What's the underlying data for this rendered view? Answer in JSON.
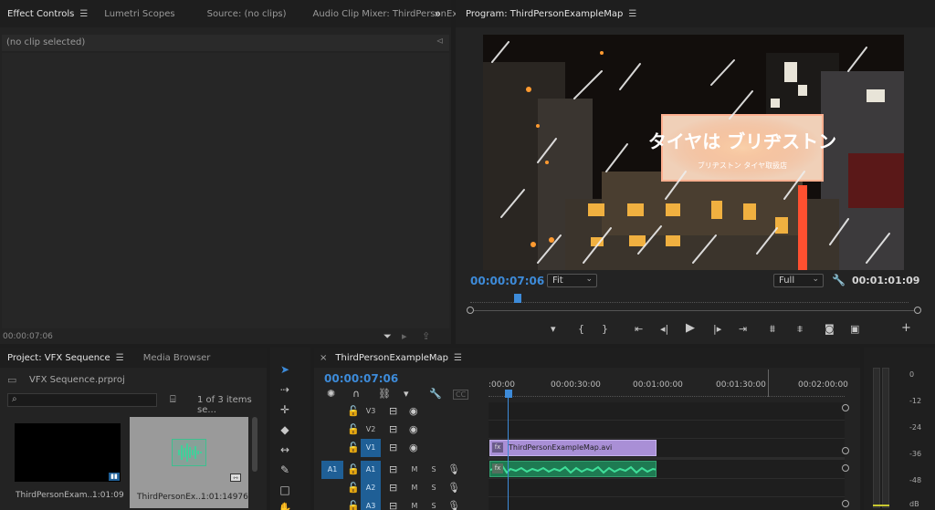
{
  "effect_panel": {
    "tabs": [
      {
        "label": "Effect Controls",
        "active": true
      },
      {
        "label": "Lumetri Scopes"
      },
      {
        "label": "Source: (no clips)"
      },
      {
        "label": "Audio Clip Mixer: ThirdPersonExampleM"
      }
    ],
    "no_clip": "(no clip selected)",
    "timecode": "00:00:07:06",
    "more_icon": "»"
  },
  "program": {
    "title": "Program: ThirdPersonExampleMap",
    "timecode": "00:00:07:06",
    "fit": "Fit",
    "quality": "Full",
    "duration": "00:01:01:09",
    "sign_text": "タイヤは ブリヂストン",
    "sign_sub": "ブリヂストン タイヤ取扱店"
  },
  "project": {
    "tabs": [
      {
        "label": "Project: VFX Sequence",
        "active": true
      },
      {
        "label": "Media Browser"
      }
    ],
    "file": "VFX Sequence.prproj",
    "count": "1 of 3 items se...",
    "items": [
      {
        "name": "ThirdPersonExam...",
        "duration": "1:01:09"
      },
      {
        "name": "ThirdPersonEx...",
        "duration": "1:01:14976"
      }
    ]
  },
  "timeline": {
    "title": "ThirdPersonExampleMap",
    "timecode": "00:00:07:06",
    "ruler": [
      ":00:00",
      "00:00:30:00",
      "00:01:00:00",
      "00:01:30:00",
      "00:02:00:00"
    ],
    "tracks": {
      "v3": "V3",
      "v2": "V2",
      "v1": "V1",
      "a1_src": "A1",
      "a1": "A1",
      "a2": "A2",
      "a3": "A3",
      "m": "M",
      "s": "S"
    },
    "clip": "ThirdPersonExampleMap.avi",
    "fx_badge": "fx",
    "cc": "CC"
  },
  "meter": {
    "labels": [
      "0",
      "-12",
      "-24",
      "-36",
      "-48",
      "dB"
    ]
  }
}
